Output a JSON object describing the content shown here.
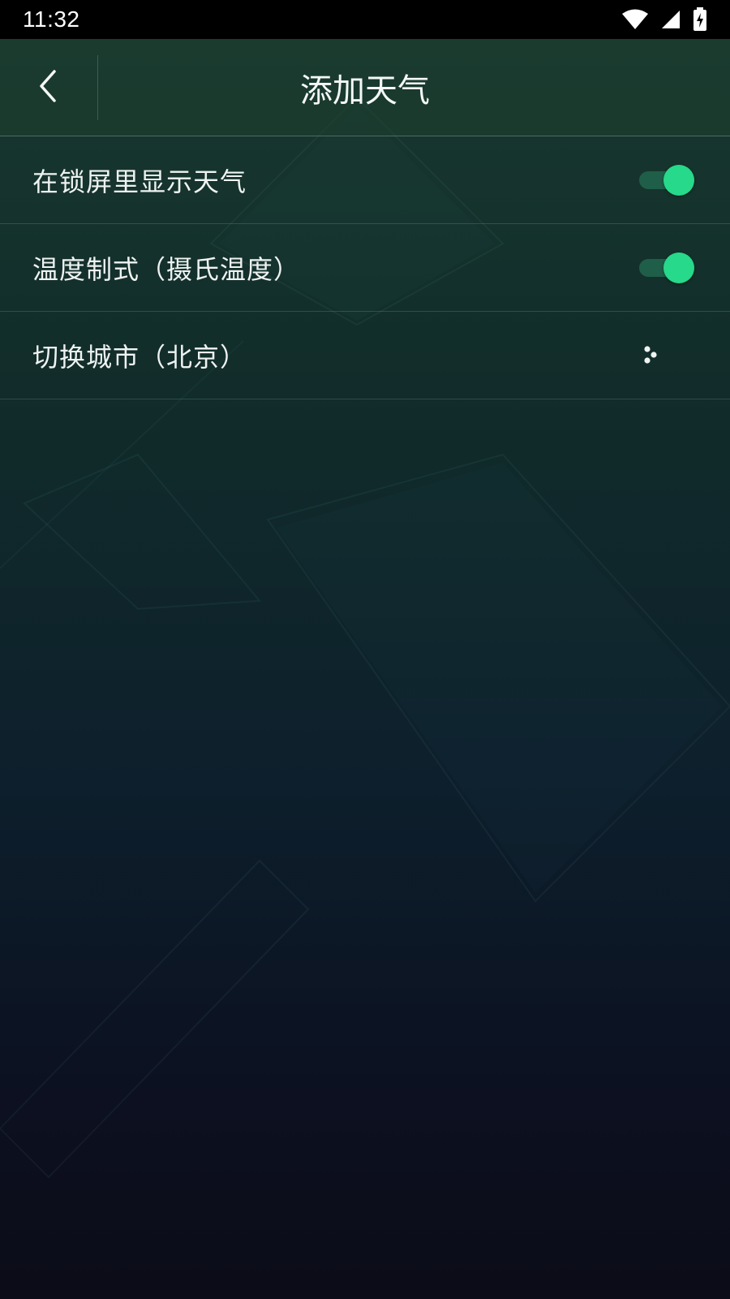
{
  "status_bar": {
    "time": "11:32",
    "icons": [
      "wifi-icon",
      "cellular-signal-icon",
      "battery-charging-icon"
    ]
  },
  "header": {
    "title": "添加天气",
    "back_icon": "chevron-left-icon"
  },
  "settings": [
    {
      "label": "在锁屏里显示天气",
      "control": "toggle",
      "on": true
    },
    {
      "label": "温度制式（摄氏温度）",
      "control": "toggle",
      "on": true
    },
    {
      "label": "切换城市（北京）",
      "control": "menu",
      "icon": "dots-icon"
    }
  ],
  "colors": {
    "accent": "#27d98a",
    "toggle_track": "#1f5e48",
    "background_top": "#1a3a30",
    "background_bottom": "#0c0c18"
  }
}
